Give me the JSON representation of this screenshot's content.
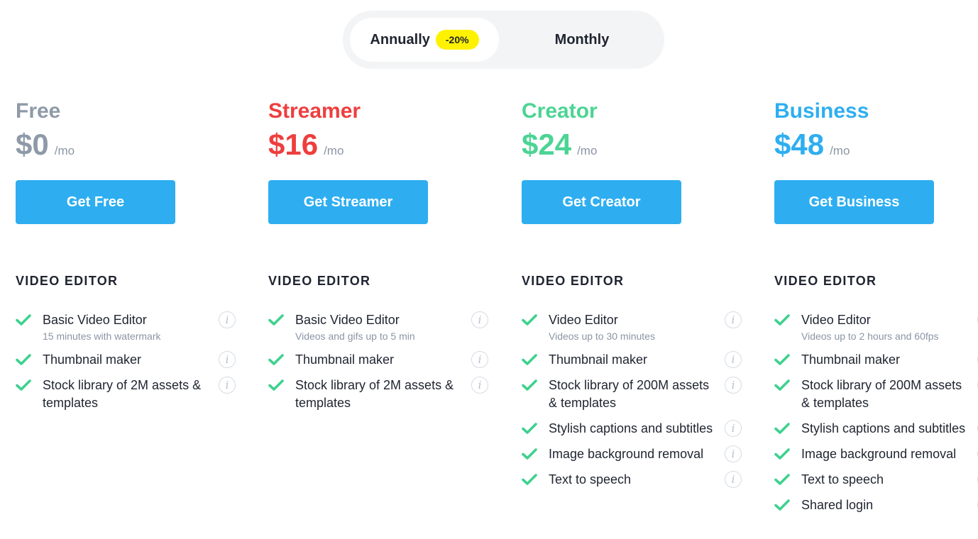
{
  "billing_toggle": {
    "annual_label": "Annually",
    "annual_badge": "-20%",
    "monthly_label": "Monthly",
    "selected": "Annually"
  },
  "colors": {
    "free": "#8f9aa8",
    "streamer": "#ee3e3e",
    "creator": "#4cd494",
    "business": "#2eaef0",
    "cta": "#2eaef0",
    "check": "#3fd18f",
    "badge": "#fff200"
  },
  "plans": [
    {
      "name": "Free",
      "price": "$0",
      "period": "/mo",
      "cta": "Get Free",
      "section": "VIDEO EDITOR",
      "features": [
        {
          "label": "Basic Video Editor",
          "sub": "15 minutes with watermark"
        },
        {
          "label": "Thumbnail maker",
          "sub": ""
        },
        {
          "label": "Stock library of 2M assets & templates",
          "sub": ""
        }
      ]
    },
    {
      "name": "Streamer",
      "price": "$16",
      "period": "/mo",
      "cta": "Get Streamer",
      "section": "VIDEO EDITOR",
      "features": [
        {
          "label": "Basic Video Editor",
          "sub": "Videos and gifs up to 5 min"
        },
        {
          "label": "Thumbnail maker",
          "sub": ""
        },
        {
          "label": "Stock library of 2M assets & templates",
          "sub": ""
        }
      ]
    },
    {
      "name": "Creator",
      "price": "$24",
      "period": "/mo",
      "cta": "Get Creator",
      "section": "VIDEO EDITOR",
      "features": [
        {
          "label": "Video Editor",
          "sub": "Videos up to 30 minutes"
        },
        {
          "label": "Thumbnail maker",
          "sub": ""
        },
        {
          "label": "Stock library of 200M assets & templates",
          "sub": ""
        },
        {
          "label": "Stylish captions and subtitles",
          "sub": ""
        },
        {
          "label": "Image background removal",
          "sub": ""
        },
        {
          "label": "Text to speech",
          "sub": ""
        }
      ]
    },
    {
      "name": "Business",
      "price": "$48",
      "period": "/mo",
      "cta": "Get Business",
      "section": "VIDEO EDITOR",
      "features": [
        {
          "label": "Video Editor",
          "sub": "Videos up to 2 hours and 60fps"
        },
        {
          "label": "Thumbnail maker",
          "sub": ""
        },
        {
          "label": "Stock library of 200M assets & templates",
          "sub": ""
        },
        {
          "label": "Stylish captions and subtitles",
          "sub": ""
        },
        {
          "label": "Image background removal",
          "sub": ""
        },
        {
          "label": "Text to speech",
          "sub": ""
        },
        {
          "label": "Shared login",
          "sub": ""
        }
      ]
    }
  ],
  "icons": {
    "check": "check-icon",
    "info": "info-icon",
    "info_glyph": "i"
  }
}
